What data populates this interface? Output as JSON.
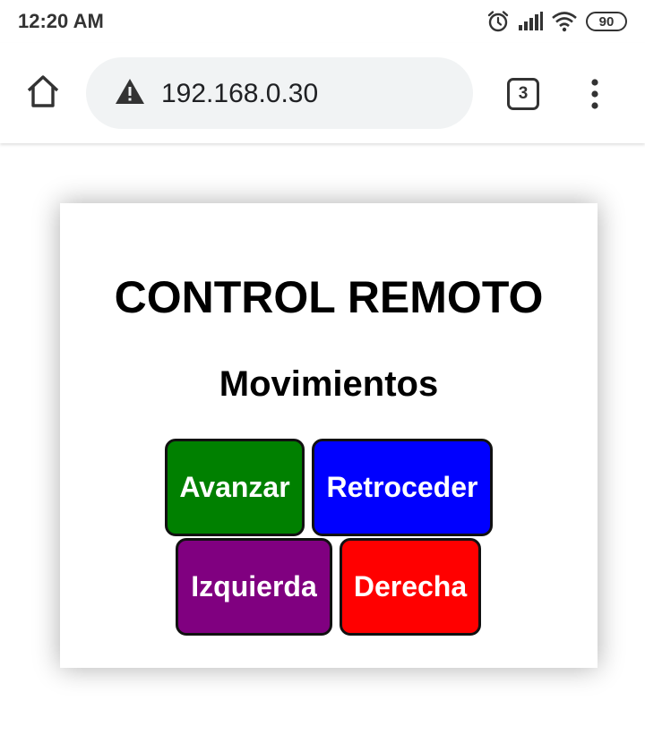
{
  "status_bar": {
    "time": "12:20 AM",
    "battery": "90",
    "icons": [
      "alarm-icon",
      "signal-icon",
      "wifi-icon",
      "battery-icon"
    ]
  },
  "browser": {
    "url": "192.168.0.30",
    "tab_count": "3",
    "icons": [
      "home-icon",
      "warning-icon",
      "overflow-menu-icon"
    ]
  },
  "page": {
    "title": "CONTROL REMOTO",
    "section_title": "Movimientos",
    "buttons": [
      {
        "label": "Avanzar",
        "color": "#008000"
      },
      {
        "label": "Retroceder",
        "color": "#0000ff"
      },
      {
        "label": "Izquierda",
        "color": "#800080"
      },
      {
        "label": "Derecha",
        "color": "#ff0000"
      }
    ]
  }
}
